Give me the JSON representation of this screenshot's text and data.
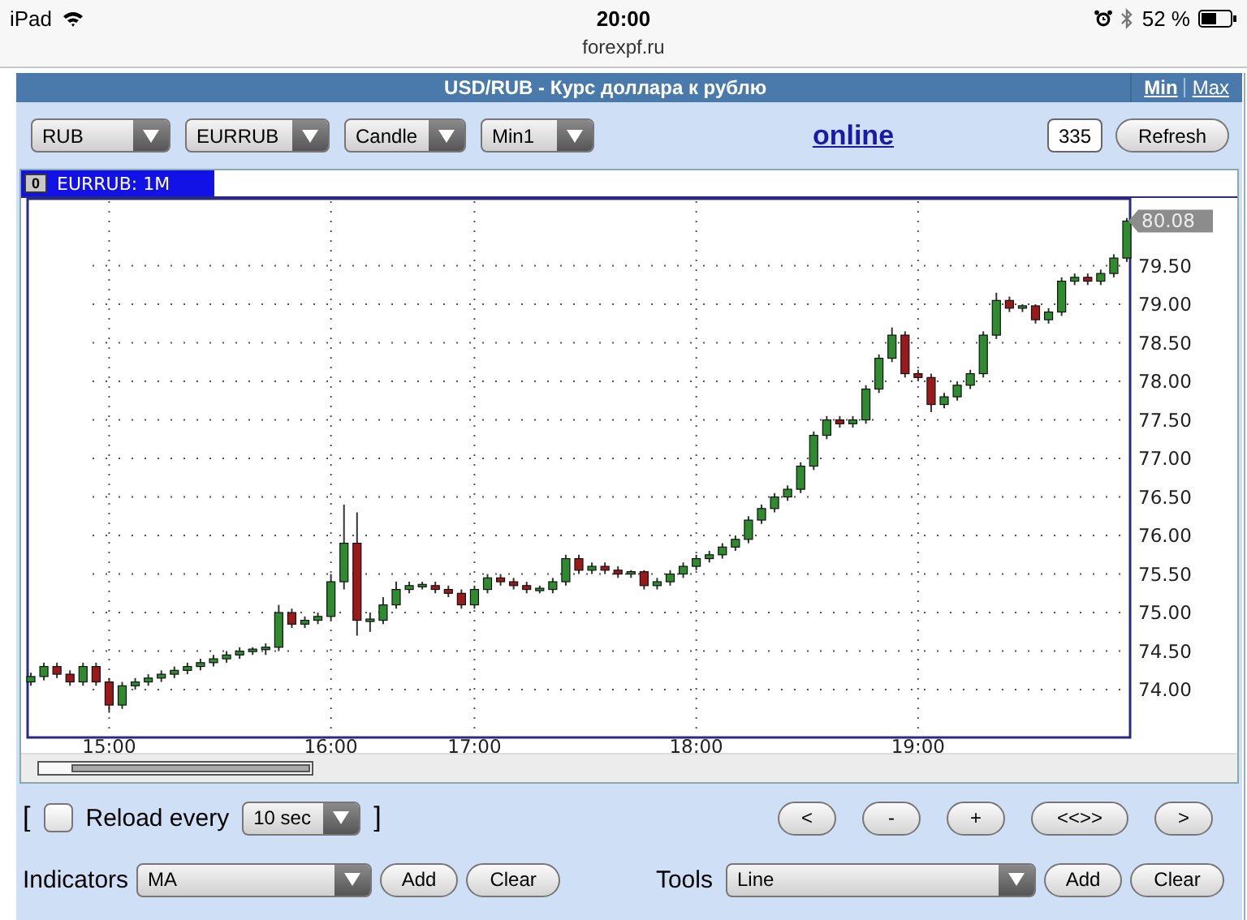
{
  "status_bar": {
    "device": "iPad",
    "time": "20:00",
    "battery": "52 %"
  },
  "address": "forexpf.ru",
  "panel": {
    "title": "USD/RUB - Курс доллара к рублю",
    "links": [
      "Min",
      "Max"
    ],
    "toolbar": {
      "selects": [
        "RUB",
        "EURRUB",
        "Candle",
        "Min1"
      ],
      "status_link": "online",
      "count": "335",
      "refresh": "Refresh"
    },
    "chart": {
      "tab_index": "0",
      "tab_label": "EURRUB: 1M",
      "chart_data": {
        "type": "candlestick",
        "categories": [
          null,
          null,
          null,
          null,
          null,
          null,
          "15:00",
          null,
          null,
          null,
          null,
          null,
          null,
          null,
          null,
          null,
          null,
          null,
          null,
          null,
          null,
          null,
          null,
          "16:00",
          null,
          null,
          null,
          null,
          null,
          null,
          null,
          null,
          null,
          null,
          "17:00",
          null,
          null,
          null,
          null,
          null,
          null,
          null,
          null,
          null,
          null,
          null,
          null,
          null,
          null,
          null,
          null,
          "18:00",
          null,
          null,
          null,
          null,
          null,
          null,
          null,
          null,
          null,
          null,
          null,
          null,
          null,
          null,
          null,
          null,
          "19:00",
          null,
          null,
          null,
          null,
          null,
          null,
          null,
          null,
          null,
          null,
          null,
          null,
          null,
          null,
          null,
          null
        ],
        "ohlc": [
          [
            74.1,
            74.22,
            74.05,
            74.17
          ],
          [
            74.17,
            74.35,
            74.12,
            74.3
          ],
          [
            74.3,
            74.35,
            74.15,
            74.2
          ],
          [
            74.2,
            74.25,
            74.05,
            74.1
          ],
          [
            74.1,
            74.35,
            74.05,
            74.3
          ],
          [
            74.3,
            74.35,
            74.05,
            74.1
          ],
          [
            74.1,
            74.15,
            73.7,
            73.8
          ],
          [
            73.8,
            74.1,
            73.75,
            74.05
          ],
          [
            74.05,
            74.15,
            74.0,
            74.1
          ],
          [
            74.1,
            74.2,
            74.05,
            74.15
          ],
          [
            74.15,
            74.25,
            74.1,
            74.2
          ],
          [
            74.2,
            74.3,
            74.15,
            74.25
          ],
          [
            74.25,
            74.35,
            74.2,
            74.3
          ],
          [
            74.3,
            74.4,
            74.25,
            74.35
          ],
          [
            74.35,
            74.45,
            74.3,
            74.4
          ],
          [
            74.4,
            74.5,
            74.35,
            74.45
          ],
          [
            74.45,
            74.55,
            74.4,
            74.5
          ],
          [
            74.5,
            74.55,
            74.45,
            74.52
          ],
          [
            74.52,
            74.6,
            74.45,
            74.55
          ],
          [
            74.55,
            75.1,
            74.5,
            75.0
          ],
          [
            75.0,
            75.05,
            74.8,
            74.85
          ],
          [
            74.85,
            74.95,
            74.8,
            74.9
          ],
          [
            74.9,
            75.0,
            74.85,
            74.95
          ],
          [
            74.95,
            75.5,
            74.9,
            75.4
          ],
          [
            75.4,
            76.4,
            75.3,
            75.9
          ],
          [
            75.9,
            76.3,
            74.7,
            74.9
          ],
          [
            74.9,
            75.0,
            74.75,
            74.9
          ],
          [
            74.9,
            75.2,
            74.85,
            75.1
          ],
          [
            75.1,
            75.4,
            75.05,
            75.3
          ],
          [
            75.3,
            75.4,
            75.25,
            75.35
          ],
          [
            75.35,
            75.4,
            75.3,
            75.35
          ],
          [
            75.35,
            75.4,
            75.25,
            75.3
          ],
          [
            75.3,
            75.35,
            75.2,
            75.25
          ],
          [
            75.25,
            75.3,
            75.05,
            75.1
          ],
          [
            75.1,
            75.35,
            75.05,
            75.3
          ],
          [
            75.3,
            75.5,
            75.25,
            75.45
          ],
          [
            75.45,
            75.5,
            75.35,
            75.4
          ],
          [
            75.4,
            75.45,
            75.3,
            75.35
          ],
          [
            75.35,
            75.4,
            75.25,
            75.3
          ],
          [
            75.3,
            75.35,
            75.25,
            75.3
          ],
          [
            75.3,
            75.45,
            75.25,
            75.4
          ],
          [
            75.4,
            75.75,
            75.35,
            75.7
          ],
          [
            75.7,
            75.75,
            75.5,
            75.55
          ],
          [
            75.55,
            75.65,
            75.5,
            75.6
          ],
          [
            75.6,
            75.65,
            75.5,
            75.55
          ],
          [
            75.55,
            75.6,
            75.45,
            75.5
          ],
          [
            75.5,
            75.55,
            75.45,
            75.53
          ],
          [
            75.53,
            75.55,
            75.3,
            75.35
          ],
          [
            75.35,
            75.45,
            75.3,
            75.4
          ],
          [
            75.4,
            75.55,
            75.35,
            75.5
          ],
          [
            75.5,
            75.65,
            75.45,
            75.6
          ],
          [
            75.6,
            75.75,
            75.55,
            75.7
          ],
          [
            75.7,
            75.8,
            75.65,
            75.75
          ],
          [
            75.75,
            75.9,
            75.7,
            75.85
          ],
          [
            75.85,
            76.0,
            75.8,
            75.95
          ],
          [
            75.95,
            76.25,
            75.9,
            76.2
          ],
          [
            76.2,
            76.4,
            76.15,
            76.35
          ],
          [
            76.35,
            76.55,
            76.3,
            76.5
          ],
          [
            76.5,
            76.65,
            76.45,
            76.6
          ],
          [
            76.6,
            76.95,
            76.55,
            76.9
          ],
          [
            76.9,
            77.35,
            76.85,
            77.3
          ],
          [
            77.3,
            77.55,
            77.25,
            77.5
          ],
          [
            77.5,
            77.55,
            77.4,
            77.45
          ],
          [
            77.45,
            77.55,
            77.4,
            77.5
          ],
          [
            77.5,
            77.95,
            77.45,
            77.9
          ],
          [
            77.9,
            78.35,
            77.85,
            78.3
          ],
          [
            78.3,
            78.7,
            78.25,
            78.6
          ],
          [
            78.6,
            78.65,
            78.05,
            78.1
          ],
          [
            78.1,
            78.15,
            78.0,
            78.05
          ],
          [
            78.05,
            78.1,
            77.6,
            77.7
          ],
          [
            77.7,
            77.85,
            77.65,
            77.8
          ],
          [
            77.8,
            78.0,
            77.75,
            77.95
          ],
          [
            77.95,
            78.15,
            77.9,
            78.1
          ],
          [
            78.1,
            78.65,
            78.05,
            78.6
          ],
          [
            78.6,
            79.15,
            78.55,
            79.05
          ],
          [
            79.05,
            79.1,
            78.9,
            78.95
          ],
          [
            78.95,
            79.0,
            78.9,
            78.98
          ],
          [
            78.98,
            79.0,
            78.75,
            78.8
          ],
          [
            78.8,
            78.95,
            78.75,
            78.9
          ],
          [
            78.9,
            79.35,
            78.85,
            79.3
          ],
          [
            79.3,
            79.4,
            79.25,
            79.35
          ],
          [
            79.35,
            79.4,
            79.25,
            79.3
          ],
          [
            79.3,
            79.45,
            79.25,
            79.4
          ],
          [
            79.4,
            79.65,
            79.35,
            79.6
          ],
          [
            79.6,
            80.12,
            79.55,
            80.08
          ]
        ],
        "ylim": [
          73.39,
          80.38
        ],
        "yticks": [
          {
            "value": 74,
            "label": "74.00"
          },
          {
            "value": 74.5,
            "label": "74.50"
          },
          {
            "value": 75,
            "label": "75.00"
          },
          {
            "value": 75.5,
            "label": "75.50"
          },
          {
            "value": 76,
            "label": "76.00"
          },
          {
            "value": 76.5,
            "label": "76.50"
          },
          {
            "value": 77,
            "label": "77.00"
          },
          {
            "value": 77.5,
            "label": "77.50"
          },
          {
            "value": 78,
            "label": "78.00"
          },
          {
            "value": 78.5,
            "label": "78.50"
          },
          {
            "value": 79,
            "label": "79.00"
          },
          {
            "value": 79.5,
            "label": "79.50"
          }
        ],
        "grid": true,
        "annotations": [
          "80.08"
        ]
      }
    },
    "reload": {
      "open_bracket": "[",
      "checked": false,
      "label": "Reload every",
      "interval": "10 sec",
      "close_bracket": "]"
    },
    "nav_buttons": [
      "<",
      "-",
      "+",
      "<<>>",
      ">"
    ],
    "indicators": {
      "label": "Indicators",
      "value": "MA",
      "add": "Add",
      "clear": "Clear"
    },
    "tools": {
      "label": "Tools",
      "value": "Line",
      "add": "Add",
      "clear": "Clear"
    }
  }
}
